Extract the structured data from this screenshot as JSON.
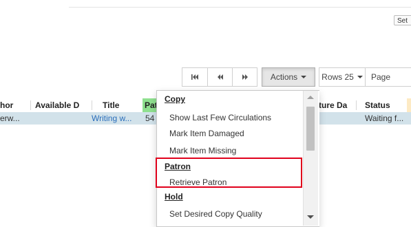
{
  "top_bar": {
    "set_button_label": "Set"
  },
  "toolbar": {
    "first_icon": "first-page-icon",
    "prev_icon": "previous-page-icon",
    "next_icon": "next-page-icon",
    "actions_label": "Actions",
    "rows_label": "Rows 25",
    "page_label": "Page"
  },
  "grid": {
    "headers": {
      "author": "hor",
      "available": "Available D",
      "title": "Title",
      "patron": "Pat",
      "capture": "ture Da",
      "status": "Status"
    },
    "row": {
      "author": "erw...",
      "title": "Writing w...",
      "patron": "54",
      "status": "Waiting f..."
    },
    "colors": {
      "patron_header": "#8fe08f",
      "selected_row": "#d2e2ea"
    }
  },
  "actions_menu": {
    "sections": [
      {
        "label": "Copy",
        "items": [
          "Show Last Few Circulations",
          "Mark Item Damaged",
          "Mark Item Missing"
        ]
      },
      {
        "label": "Patron",
        "items": [
          "Retrieve Patron"
        ]
      },
      {
        "label": "Hold",
        "items": [
          "Set Desired Copy Quality"
        ]
      }
    ],
    "highlight_color": "#e0001b"
  }
}
